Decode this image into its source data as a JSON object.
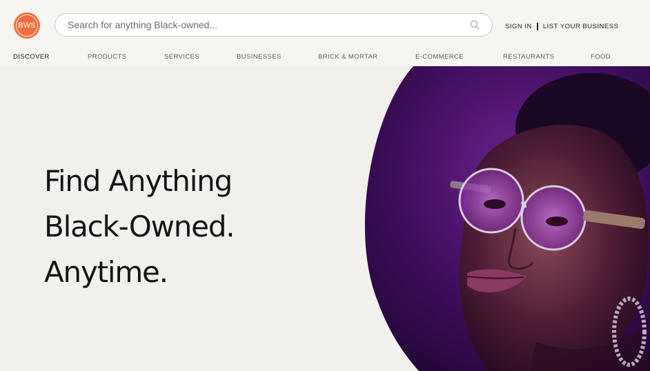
{
  "logo": {
    "text": "BWS",
    "color": "#f26d3d"
  },
  "search": {
    "placeholder": "Search for anything Black-owned...",
    "icon": "search-icon"
  },
  "auth": {
    "sign_in": "SIGN IN",
    "list_business": "LIST YOUR BUSINESS"
  },
  "nav": {
    "items": [
      {
        "label": "DISCOVER"
      },
      {
        "label": "PRODUCTS"
      },
      {
        "label": "SERVICES"
      },
      {
        "label": "BUSINESSES"
      },
      {
        "label": "BRICK & MORTAR"
      },
      {
        "label": "E-COMMERCE"
      },
      {
        "label": "RESTAURANTS"
      },
      {
        "label": "FOOD"
      }
    ]
  },
  "hero": {
    "line1": "Find Anything",
    "line2": "Black-Owned.",
    "line3": "Anytime."
  },
  "colors": {
    "header_bg": "#f7f5f2",
    "page_bg": "#f2f0ed",
    "accent": "#f26d3d",
    "hero_purple": "#5a1a78"
  }
}
